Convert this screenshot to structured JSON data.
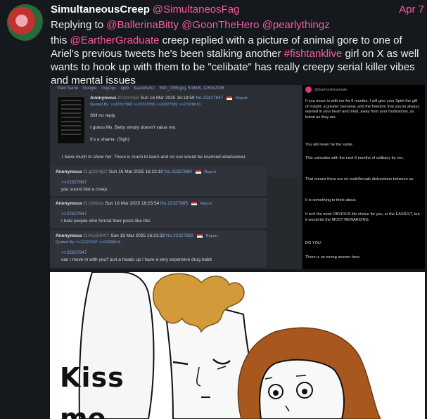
{
  "author": {
    "display_name": "SimultaneousCreep",
    "handle": "@SimultaneosFag",
    "date": "Apr 7",
    "avatar_icon": "avatar-photo"
  },
  "reply": {
    "prefix": "Replying to",
    "mentions": [
      "@BallerinaBitty",
      "@GoonTheHero",
      "@pearlythingz"
    ]
  },
  "body": {
    "t1": "this ",
    "mention": "@EartherGraduate",
    "t2": " creep replied with a picture of animal gore to one of Ariel's previous tweets he's been stalking another ",
    "hashtag": "#fishtanklive",
    "t3": " girl on X as well wants to hook up with them to be \"celibate\" has really creepy serial killer vibes and mental issues"
  },
  "colors": {
    "accent": "#fb59a7",
    "bg": "#15181c",
    "link": "#7fa8e8"
  },
  "screenshot": {
    "chan_bar": [
      "View Same",
      "Google",
      "ImgOps",
      "iqdb",
      "SauceNAO",
      "IMG_0335.jpg, 509KB, 1263x2096"
    ],
    "op": {
      "name": "Anonymous",
      "id": "ID:2mYrp5t",
      "datetime": "Sun 16 Mar 2025 16:19:59",
      "number": "No.22327847",
      "report": "Report",
      "quoted_by": "Quoted By: >>22327860 >>22327865 >>22327892 >>22328016",
      "lines": [
        "Still no reply.",
        "I guess Ms. Betty simply doesn't value me.",
        "It's a shame. (Sigh)",
        "I have much to show her. There is much to learn and no sex would be involved whatsoever."
      ]
    },
    "replies": [
      {
        "name": "Anonymous",
        "id": "ID:gOOv8j22",
        "datetime": "Sun 16 Mar 2025 16:23:10",
        "number": "No.22327860",
        "report": "Report",
        "quoted_by": "",
        "quote": ">>22327847",
        "text": "you sound like a creep"
      },
      {
        "name": "Anonymous",
        "id": "ID:I1Nilzax",
        "datetime": "Sun 16 Mar 2025 16:23:54",
        "number": "No.22327865",
        "report": "Report",
        "quoted_by": "",
        "quote": ">>22327847",
        "text": "I hate people who format their posts like this"
      },
      {
        "name": "Anonymous",
        "id": "ID:Kvv5NH9Y",
        "datetime": "Sun 16 Mar 2025 16:31:22",
        "number": "No.22327892",
        "report": "Report",
        "quoted_by": "Quoted By: >>22327937 >>22328016",
        "quote": ">>22327847",
        "text": "can i move in with you? just a heads up i have a very expensive drug habit"
      }
    ],
    "tweet": {
      "handle": "@EartherGraduate",
      "lines": [
        "If you move in with me for 6 months, I will give your Spirit the gift of insight, a greater overview, and the freedom that you've always wanted in your heart and mind, away from your frustrations, as banal as they are.",
        "You will never be the same.",
        "This coincides with the next 6 months of celibacy for me.",
        "That means there are no male/female distractions between us.",
        "It is something to think about.",
        "It isn't the most OBVIOUS life choice for you, or the EASIEST, but it would be the MOST REWARDING.",
        "DO YOU.",
        "There is no wrong answer here."
      ]
    }
  },
  "comic": {
    "caption_1": "Kiss",
    "caption_2": "me"
  }
}
